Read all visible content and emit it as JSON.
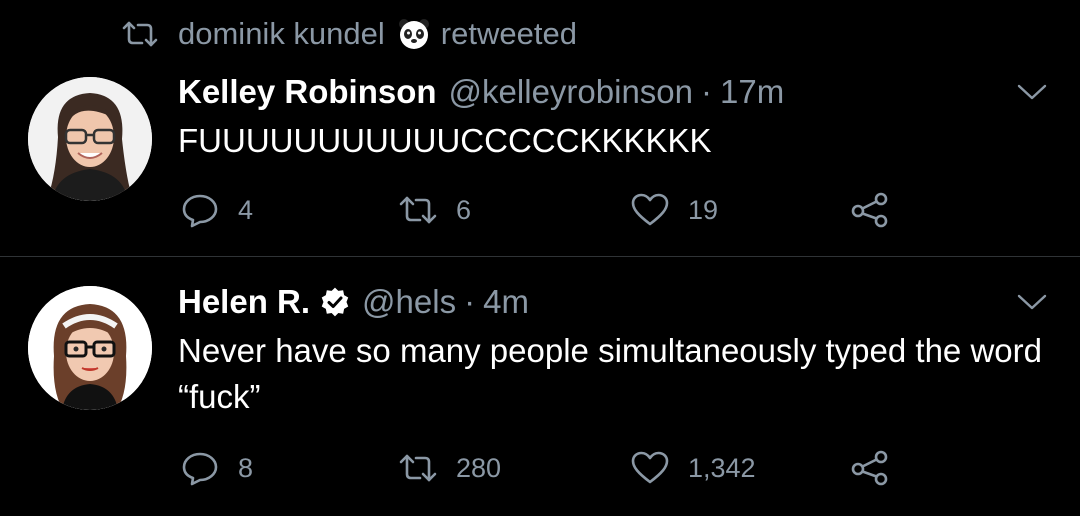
{
  "tweet1": {
    "retweet_user": "dominik kundel",
    "retweet_label": "retweeted",
    "author_name": "Kelley Robinson",
    "handle": "@kelleyrobinson",
    "separator": "·",
    "time": "17m",
    "text": "FUUUUUUUUUUUCCCCCKKKKKK",
    "replies": "4",
    "retweets": "6",
    "likes": "19"
  },
  "tweet2": {
    "author_name": "Helen R.",
    "handle": "@hels",
    "separator": "·",
    "time": "4m",
    "text": "Never have so many people simultaneously typed the word “fuck”",
    "replies": "8",
    "retweets": "280",
    "likes": "1,342"
  },
  "icons": {
    "retweet": "retweet-icon",
    "reply": "reply-icon",
    "like": "heart-icon",
    "share": "share-icon",
    "more": "chevron-down-icon",
    "verified": "verified-badge-icon"
  },
  "colors": {
    "background": "#000000",
    "secondary_text": "#8b98a5",
    "primary_text": "#ffffff",
    "divider": "#2f3336"
  }
}
